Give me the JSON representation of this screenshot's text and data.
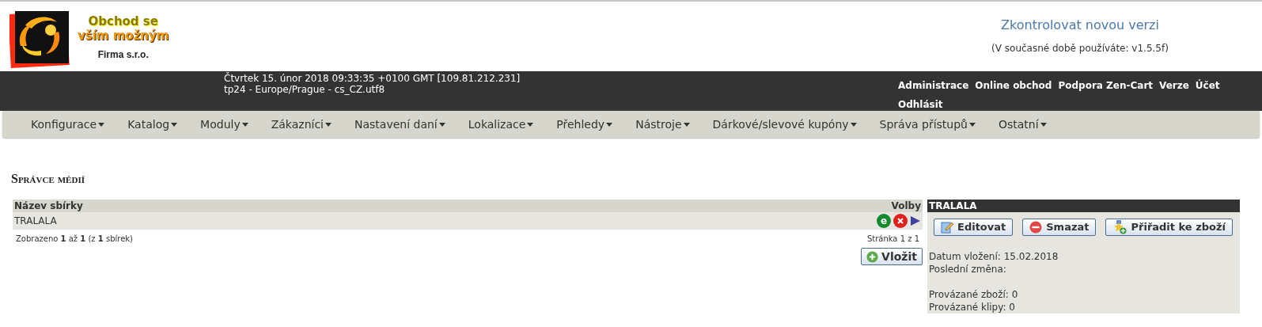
{
  "logo": {
    "line_1": "Obchod se",
    "line_2": "vším možným",
    "company": "Firma s.r.o."
  },
  "version": {
    "link": "Zkontrolovat novou verzi",
    "note": "(V současné době používáte: v1.5.5f)"
  },
  "info_bar": {
    "date": "Čtvrtek 15. únor 2018 09:33:35 +0100 GMT [109.81.212.231]",
    "locale": "tp24 - Europe/Prague - cs_CZ.utf8",
    "links": [
      "Administrace",
      "Online obchod",
      "Podpora Zen-Cart",
      "Verze",
      "Účet",
      "Odhlásit"
    ]
  },
  "menu": [
    "Konfigurace",
    "Katalog",
    "Moduly",
    "Zákazníci",
    "Nastavení daní",
    "Lokalizace",
    "Přehledy",
    "Nástroje",
    "Dárkové/slevové kupóny",
    "Správa přístupů",
    "Ostatní"
  ],
  "page_title": "Správce médií",
  "table": {
    "columns": [
      "Název sbírky",
      "Volby"
    ],
    "rows": [
      {
        "name": "TRALALA",
        "edit_icon": "e",
        "selected": true
      }
    ],
    "summary": "Zobrazeno **1** až **1** (z **1** sbírek)",
    "pages": "Stránka 1 z 1",
    "insert_button": "Vložit"
  },
  "detail": {
    "title": "TRALALA",
    "buttons": [
      {
        "kind": "edit",
        "label": "Editovat"
      },
      {
        "kind": "delete",
        "label": "Smazat"
      },
      {
        "kind": "assign",
        "label": "Přiřadit ke zboží"
      }
    ],
    "dates": [
      "Datum vložení: 15.02.2018",
      "Poslední změna:"
    ],
    "links": [
      "Provázané zboží: 0",
      "Provázané klipy: 0"
    ]
  }
}
